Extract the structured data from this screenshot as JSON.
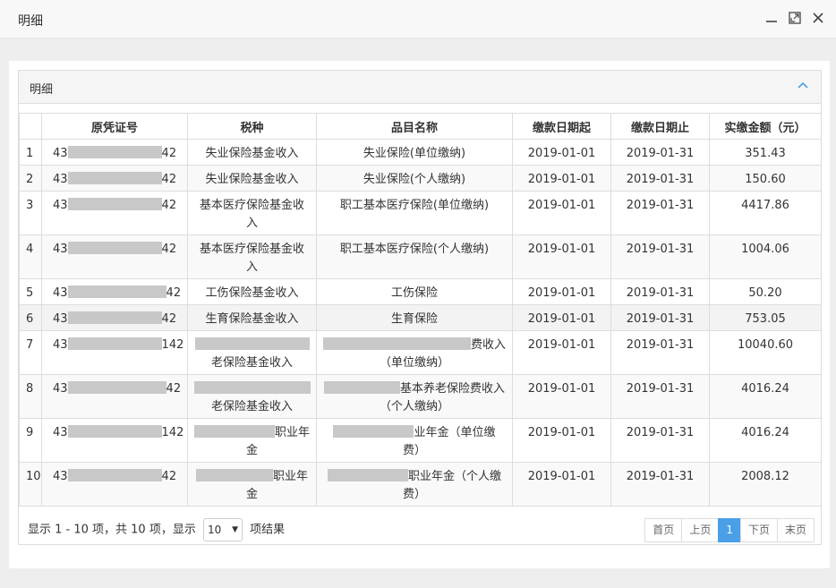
{
  "window": {
    "title": "明细"
  },
  "panel": {
    "title": "明细"
  },
  "table": {
    "headers": [
      "",
      "原凭证号",
      "税种",
      "品目名称",
      "缴款日期起",
      "缴款日期止",
      "实缴金额（元）"
    ],
    "rows": [
      {
        "no": "1",
        "cert_prefix": "43",
        "cert_suffix": "42",
        "tax": "失业保险基金收入",
        "tax2": "",
        "item": "失业保险(单位缴纳)",
        "item2": "",
        "from": "2019-01-01",
        "to": "2019-01-31",
        "amount": "351.43"
      },
      {
        "no": "2",
        "cert_prefix": "43",
        "cert_suffix": "42",
        "tax": "失业保险基金收入",
        "tax2": "",
        "item": "失业保险(个人缴纳)",
        "item2": "",
        "from": "2019-01-01",
        "to": "2019-01-31",
        "amount": "150.60"
      },
      {
        "no": "3",
        "cert_prefix": "43",
        "cert_suffix": "42",
        "tax": "基本医疗保险基金收",
        "tax2": "入",
        "item": "职工基本医疗保险(单位缴纳)",
        "item2": "",
        "from": "2019-01-01",
        "to": "2019-01-31",
        "amount": "4417.86"
      },
      {
        "no": "4",
        "cert_prefix": "43",
        "cert_suffix": "42",
        "tax": "基本医疗保险基金收",
        "tax2": "入",
        "item": "职工基本医疗保险(个人缴纳)",
        "item2": "",
        "from": "2019-01-01",
        "to": "2019-01-31",
        "amount": "1004.06"
      },
      {
        "no": "5",
        "cert_prefix": "43",
        "cert_suffix": "42",
        "tax": "工伤保险基金收入",
        "tax2": "",
        "item": "工伤保险",
        "item2": "",
        "from": "2019-01-01",
        "to": "2019-01-31",
        "amount": "50.20"
      },
      {
        "no": "6",
        "cert_prefix": "43",
        "cert_suffix": "42",
        "tax": "生育保险基金收入",
        "tax2": "",
        "item": "生育保险",
        "item2": "",
        "from": "2019-01-01",
        "to": "2019-01-31",
        "amount": "753.05"
      },
      {
        "no": "7",
        "cert_prefix": "43",
        "cert_suffix": "142",
        "tax": "",
        "tax2": "老保险基金收入",
        "item": "费收入",
        "item2": "（单位缴纳）",
        "from": "2019-01-01",
        "to": "2019-01-31",
        "amount": "10040.60"
      },
      {
        "no": "8",
        "cert_prefix": "43",
        "cert_suffix": "42",
        "tax": "",
        "tax2": "老保险基金收入",
        "item": "基本养老保险费收入",
        "item2": "（个人缴纳）",
        "from": "2019-01-01",
        "to": "2019-01-31",
        "amount": "4016.24"
      },
      {
        "no": "9",
        "cert_prefix": "43",
        "cert_suffix": "142",
        "tax": "职业年",
        "tax2": "金",
        "item": "业年金（单位缴",
        "item2": "费）",
        "from": "2019-01-01",
        "to": "2019-01-31",
        "amount": "4016.24"
      },
      {
        "no": "10",
        "cert_prefix": "43",
        "cert_suffix": "42",
        "tax": "职业年",
        "tax2": "金",
        "item": "职业年金（个人缴",
        "item2": "费）",
        "from": "2019-01-01",
        "to": "2019-01-31",
        "amount": "2008.12"
      }
    ]
  },
  "footer": {
    "info_prefix": "显示 1 - 10 项，共 10 项，显示",
    "page_size": "10",
    "info_suffix": "项结果"
  },
  "pager": {
    "first": "首页",
    "prev": "上页",
    "current": "1",
    "next": "下页",
    "last": "末页"
  },
  "colors": {
    "active_page": "#4a9fe7",
    "border": "#dddddd",
    "mask": "#c8c8c8"
  }
}
